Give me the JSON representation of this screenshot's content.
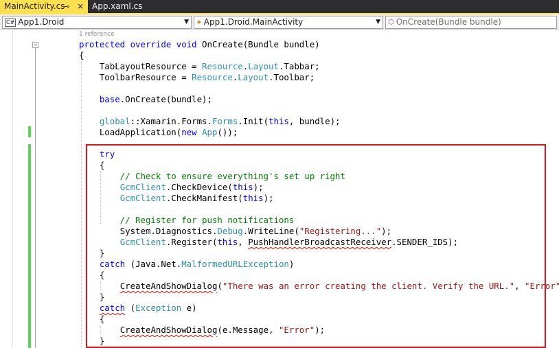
{
  "tabs": [
    {
      "label": "MainActivity.cs",
      "active": true
    },
    {
      "label": "App.xaml.cs",
      "active": false
    }
  ],
  "tab_icons": {
    "pin": "⊸",
    "close": "×"
  },
  "navbar": {
    "project": "App1.Droid",
    "project_icon": "C#",
    "class": "App1.Droid.MainActivity",
    "member": "OnCreate(Bundle bundle)"
  },
  "codelens": "1 reference",
  "code_lines": [
    "protected override void OnCreate(Bundle bundle)",
    "{",
    "    TabLayoutResource = Resource.Layout.Tabbar;",
    "    ToolbarResource = Resource.Layout.Toolbar;",
    "",
    "    base.OnCreate(bundle);",
    "",
    "    global::Xamarin.Forms.Forms.Init(this, bundle);",
    "    LoadApplication(new App());",
    "",
    "    try",
    "    {",
    "        // Check to ensure everything's set up right",
    "        GcmClient.CheckDevice(this);",
    "        GcmClient.CheckManifest(this);",
    "",
    "        // Register for push notifications",
    "        System.Diagnostics.Debug.WriteLine(\"Registering...\");",
    "        GcmClient.Register(this, PushHandlerBroadcastReceiver.SENDER_IDS);",
    "    }",
    "    catch (Java.Net.MalformedURLException)",
    "    {",
    "        CreateAndShowDialog(\"There was an error creating the client. Verify the URL.\", \"Error\");",
    "    }",
    "    catch (Exception e)",
    "    {",
    "        CreateAndShowDialog(e.Message, \"Error\");",
    "    }"
  ],
  "colors": {
    "tab_active": "#fde050",
    "highlight_border": "#e0141e",
    "keyword": "#0000ff",
    "type": "#2b91af",
    "comment": "#008000",
    "string": "#a31515",
    "change_bar": "#61d35c"
  }
}
